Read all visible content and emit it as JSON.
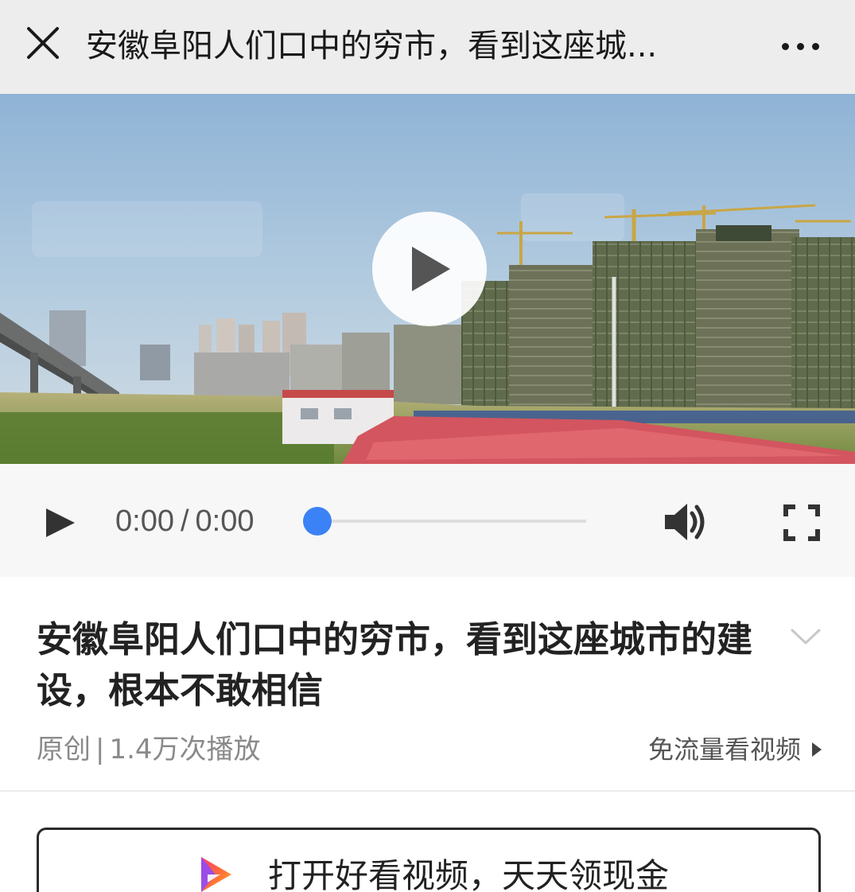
{
  "topbar": {
    "title": "安徽阜阳人们口中的穷市，看到这座城..."
  },
  "player": {
    "current_time": "0:00",
    "separator": "/",
    "duration": "0:00",
    "progress": 0,
    "accent_color": "#3b82f6"
  },
  "video_info": {
    "title": "安徽阜阳人们口中的穷市，看到这座城市的建设，根本不敢相信",
    "tag": "原创",
    "separator": "|",
    "play_count": "1.4万次播放",
    "free_data_label": "免流量看视频"
  },
  "app_banner": {
    "label": "打开好看视频，天天领现金"
  },
  "icons": [
    "close-icon",
    "more-icon",
    "play-icon",
    "volume-icon",
    "fullscreen-icon",
    "chevron-down-icon",
    "triangle-right-icon",
    "app-logo-icon"
  ]
}
